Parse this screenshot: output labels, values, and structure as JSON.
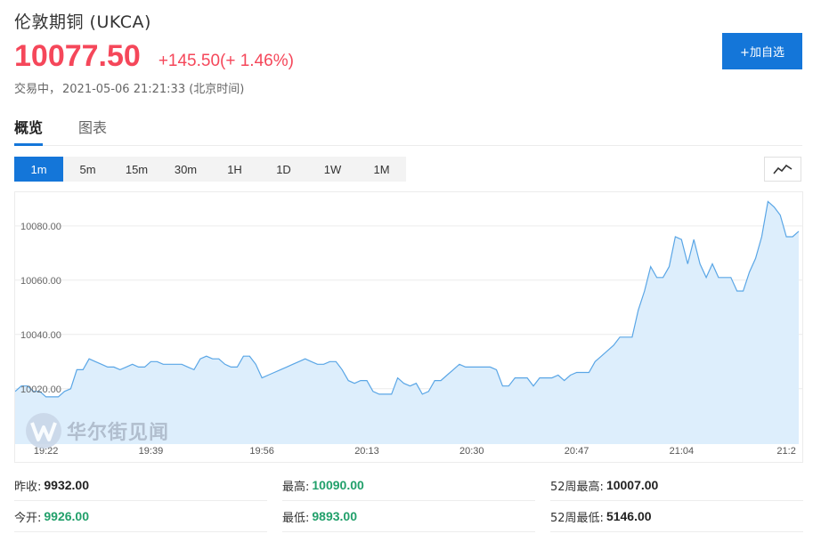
{
  "header": {
    "title": "伦敦期铜 (UKCA)",
    "price": "10077.50",
    "change": "+145.50",
    "change_pct": "(+ 1.46%)",
    "status": "交易中，",
    "timestamp": "2021-05-06 21:21:33",
    "timezone": "(北京时间)",
    "add_label": "+加自选"
  },
  "tabs": [
    {
      "label": "概览",
      "active": true
    },
    {
      "label": "图表",
      "active": false
    }
  ],
  "periods": [
    "1m",
    "5m",
    "15m",
    "30m",
    "1H",
    "1D",
    "1W",
    "1M"
  ],
  "active_period": "1m",
  "chart_type_icon": "line-chart-icon",
  "watermark": {
    "text": "华尔街见闻",
    "icon": "brand-logo-icon"
  },
  "colors": {
    "up": "#f5475a",
    "accent": "#1476d9",
    "line": "#5aa6e6",
    "fill": "#ddeefc",
    "green": "#22a06b"
  },
  "chart_data": {
    "type": "area",
    "y_ticks": [
      "10020.00",
      "10040.00",
      "10060.00",
      "10080.00"
    ],
    "y_tick_values": [
      10020,
      10040,
      10060,
      10080
    ],
    "x_ticks": [
      "19:22",
      "19:39",
      "19:56",
      "20:13",
      "20:30",
      "20:47",
      "21:04",
      "21:2"
    ],
    "x_tick_index": [
      5,
      22,
      40,
      57,
      74,
      91,
      108,
      125
    ],
    "ylim": [
      9999.6,
      10092.4
    ],
    "grid": true,
    "values": [
      10019,
      10021,
      10021,
      10019,
      10019,
      10017,
      10017,
      10017,
      10019,
      10020,
      10027,
      10027,
      10031,
      10030,
      10029,
      10028,
      10028,
      10027,
      10028,
      10029,
      10028,
      10028,
      10030,
      10030,
      10029,
      10029,
      10029,
      10029,
      10028,
      10027,
      10031,
      10032,
      10031,
      10031,
      10029,
      10028,
      10028,
      10032,
      10032,
      10029,
      10024,
      10025,
      10026,
      10027,
      10028,
      10029,
      10030,
      10031,
      10030,
      10029,
      10029,
      10030,
      10030,
      10027,
      10023,
      10022,
      10023,
      10023,
      10019,
      10018,
      10018,
      10018,
      10024,
      10022,
      10021,
      10022,
      10018,
      10019,
      10023,
      10023,
      10025,
      10027,
      10029,
      10028,
      10028,
      10028,
      10028,
      10028,
      10027,
      10021,
      10021,
      10024,
      10024,
      10024,
      10021,
      10024,
      10024,
      10024,
      10025,
      10023,
      10025,
      10026,
      10026,
      10026,
      10030,
      10032,
      10034,
      10036,
      10039,
      10039,
      10039,
      10049,
      10056,
      10065,
      10061,
      10061,
      10065,
      10076,
      10075,
      10066,
      10075,
      10066,
      10061,
      10066,
      10061,
      10061,
      10061,
      10056,
      10056,
      10063,
      10068,
      10076,
      10089,
      10087,
      10084,
      10076,
      10076,
      10078
    ]
  },
  "stats": [
    [
      {
        "label": "昨收:",
        "value": "9932.00",
        "tone": "dark"
      },
      {
        "label": "最高:",
        "value": "10090.00",
        "tone": "green"
      },
      {
        "label": "52周最高:",
        "value": "10007.00",
        "tone": "dark"
      }
    ],
    [
      {
        "label": "今开:",
        "value": "9926.00",
        "tone": "green"
      },
      {
        "label": "最低:",
        "value": "9893.00",
        "tone": "green"
      },
      {
        "label": "52周最低:",
        "value": "5146.00",
        "tone": "dark"
      }
    ]
  ]
}
